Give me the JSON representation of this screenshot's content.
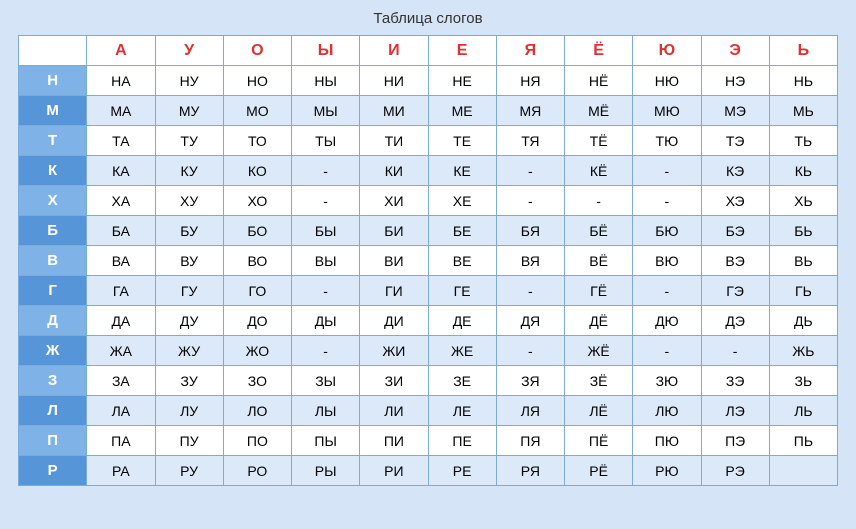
{
  "title": "Таблица слогов",
  "headers": [
    "",
    "А",
    "У",
    "О",
    "Ы",
    "И",
    "Е",
    "Я",
    "Ё",
    "Ю",
    "Э",
    "Ь"
  ],
  "rows": [
    {
      "letter": "Н",
      "cells": [
        "НА",
        "НУ",
        "НО",
        "НЫ",
        "НИ",
        "НЕ",
        "НЯ",
        "НЁ",
        "НЮ",
        "НЭ",
        "НЬ"
      ]
    },
    {
      "letter": "М",
      "cells": [
        "МА",
        "МУ",
        "МО",
        "МЫ",
        "МИ",
        "МЕ",
        "МЯ",
        "МЁ",
        "МЮ",
        "МЭ",
        "МЬ"
      ]
    },
    {
      "letter": "Т",
      "cells": [
        "ТА",
        "ТУ",
        "ТО",
        "ТЫ",
        "ТИ",
        "ТЕ",
        "ТЯ",
        "ТЁ",
        "ТЮ",
        "ТЭ",
        "ТЬ"
      ]
    },
    {
      "letter": "К",
      "cells": [
        "КА",
        "КУ",
        "КО",
        "-",
        "КИ",
        "КЕ",
        "-",
        "КЁ",
        "-",
        "КЭ",
        "КЬ"
      ]
    },
    {
      "letter": "Х",
      "cells": [
        "ХА",
        "ХУ",
        "ХО",
        "-",
        "ХИ",
        "ХЕ",
        "-",
        "-",
        "-",
        "ХЭ",
        "ХЬ"
      ]
    },
    {
      "letter": "Б",
      "cells": [
        "БА",
        "БУ",
        "БО",
        "БЫ",
        "БИ",
        "БЕ",
        "БЯ",
        "БЁ",
        "БЮ",
        "БЭ",
        "БЬ"
      ]
    },
    {
      "letter": "В",
      "cells": [
        "ВА",
        "ВУ",
        "ВО",
        "ВЫ",
        "ВИ",
        "ВЕ",
        "ВЯ",
        "ВЁ",
        "ВЮ",
        "ВЭ",
        "ВЬ"
      ]
    },
    {
      "letter": "Г",
      "cells": [
        "ГА",
        "ГУ",
        "ГО",
        "-",
        "ГИ",
        "ГЕ",
        "-",
        "ГЁ",
        "-",
        "ГЭ",
        "ГЬ"
      ]
    },
    {
      "letter": "Д",
      "cells": [
        "ДА",
        "ДУ",
        "ДО",
        "ДЫ",
        "ДИ",
        "ДЕ",
        "ДЯ",
        "ДЁ",
        "ДЮ",
        "ДЭ",
        "ДЬ"
      ]
    },
    {
      "letter": "Ж",
      "cells": [
        "ЖА",
        "ЖУ",
        "ЖО",
        "-",
        "ЖИ",
        "ЖЕ",
        "-",
        "ЖЁ",
        "-",
        "-",
        "ЖЬ"
      ]
    },
    {
      "letter": "З",
      "cells": [
        "ЗА",
        "ЗУ",
        "ЗО",
        "ЗЫ",
        "ЗИ",
        "ЗЕ",
        "ЗЯ",
        "ЗЁ",
        "ЗЮ",
        "ЗЭ",
        "ЗЬ"
      ]
    },
    {
      "letter": "Л",
      "cells": [
        "ЛА",
        "ЛУ",
        "ЛО",
        "ЛЫ",
        "ЛИ",
        "ЛЕ",
        "ЛЯ",
        "ЛЁ",
        "ЛЮ",
        "ЛЭ",
        "ЛЬ"
      ]
    },
    {
      "letter": "П",
      "cells": [
        "ПА",
        "ПУ",
        "ПО",
        "ПЫ",
        "ПИ",
        "ПЕ",
        "ПЯ",
        "ПЁ",
        "ПЮ",
        "ПЭ",
        "ПЬ"
      ]
    },
    {
      "letter": "Р",
      "cells": [
        "РА",
        "РУ",
        "РО",
        "РЫ",
        "РИ",
        "РЕ",
        "РЯ",
        "РЁ",
        "РЮ",
        "РЭ",
        ""
      ]
    }
  ]
}
